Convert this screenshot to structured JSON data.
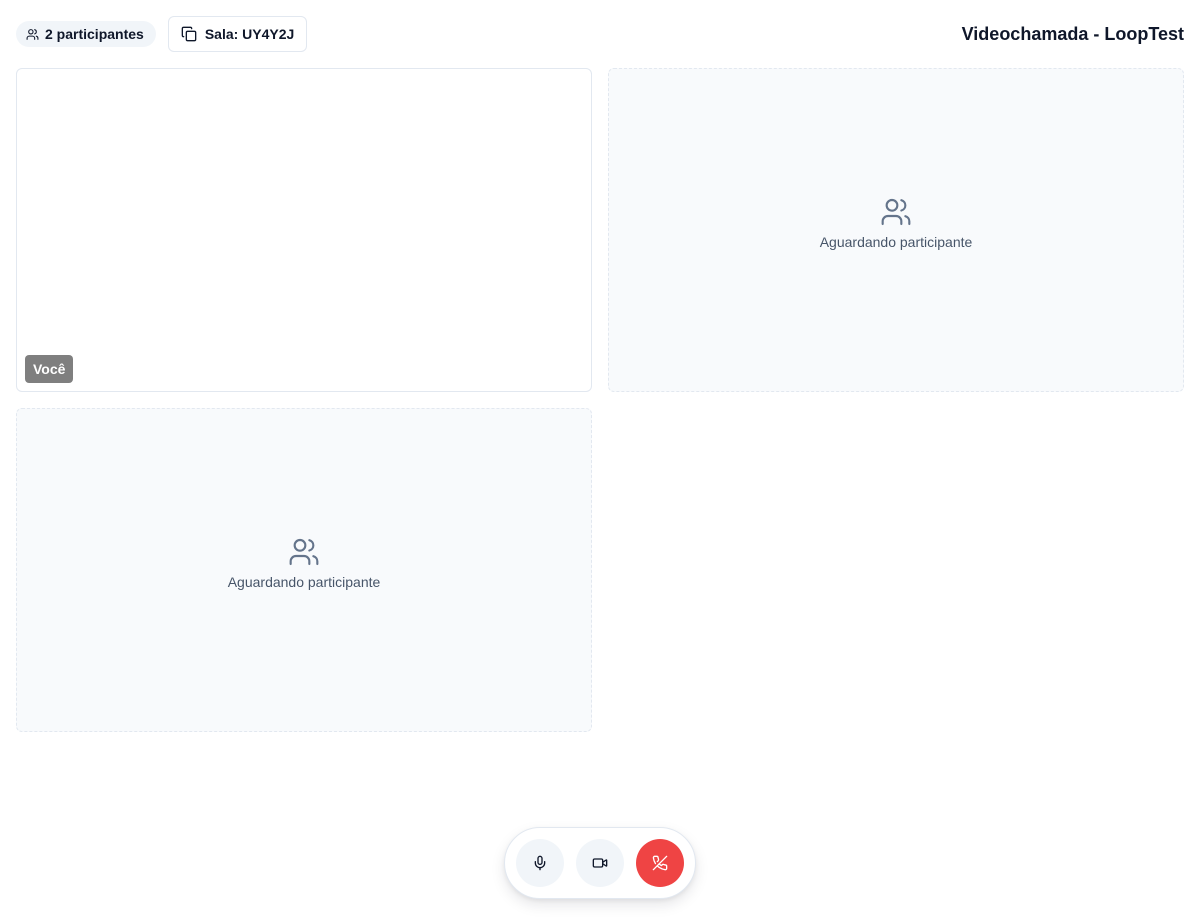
{
  "header": {
    "participants_label": "2 participantes",
    "participants_icon": "users-icon",
    "room_label": "Sala: UY4Y2J",
    "room_icon": "copy-icon",
    "title": "Videochamada - LoopTest"
  },
  "tiles": [
    {
      "type": "local",
      "label": "Você"
    },
    {
      "type": "waiting",
      "text": "Aguardando participante",
      "icon": "users-icon"
    },
    {
      "type": "waiting",
      "text": "Aguardando participante",
      "icon": "users-icon"
    }
  ],
  "controls": {
    "mic_icon": "microphone-icon",
    "camera_icon": "video-camera-icon",
    "hangup_icon": "phone-off-icon",
    "hangup_color": "#ef4444",
    "button_bg": "#f1f5f9"
  }
}
